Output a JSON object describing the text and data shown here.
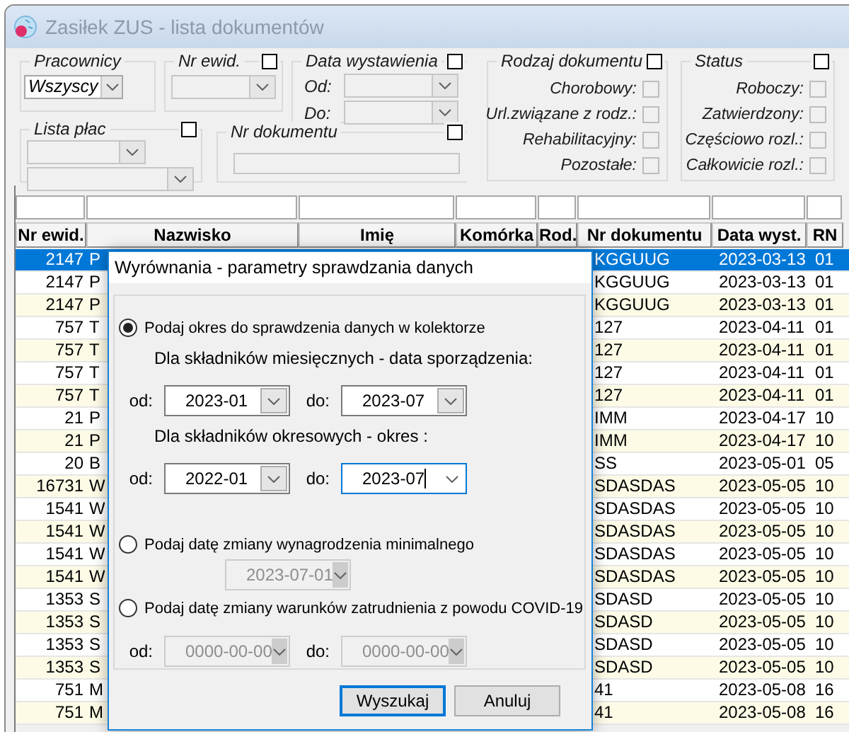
{
  "window": {
    "title": "Zasiłek ZUS - lista dokumentów"
  },
  "filters": {
    "pracownicy": {
      "label": "Pracownicy",
      "value": "Wszyscy"
    },
    "nr_ewid": {
      "label": "Nr ewid.",
      "checked": false
    },
    "data_wystawienia": {
      "label": "Data wystawienia",
      "checked": false,
      "from_label": "Od:",
      "to_label": "Do:"
    },
    "lista_plac": {
      "label": "Lista płac",
      "checked": false
    },
    "nr_dokumentu": {
      "label": "Nr dokumentu",
      "checked": false
    },
    "rodzaj_dokumentu": {
      "label": "Rodzaj dokumentu",
      "checked": false,
      "options": [
        {
          "label": "Chorobowy:",
          "checked": false,
          "disabled": true
        },
        {
          "label": "Url.związane z rodz.:",
          "checked": false,
          "disabled": true
        },
        {
          "label": "Rehabilitacyjny:",
          "checked": false,
          "disabled": true
        },
        {
          "label": "Pozostałe:",
          "checked": false,
          "disabled": true
        }
      ]
    },
    "status": {
      "label": "Status",
      "checked": false,
      "options": [
        {
          "label": "Roboczy:",
          "checked": false,
          "disabled": true
        },
        {
          "label": "Zatwierdzony:",
          "checked": false,
          "disabled": true
        },
        {
          "label": "Częściowo rozl.:",
          "checked": false,
          "disabled": true
        },
        {
          "label": "Całkowicie rozl.:",
          "checked": false,
          "disabled": true
        }
      ]
    }
  },
  "table": {
    "columns": [
      "Nr ewid.",
      "Nazwisko",
      "Imię",
      "Komórka",
      "Rod.",
      "Nr dokumentu",
      "Data wyst.",
      "RN"
    ],
    "rows": [
      {
        "nr_ewid": "2147",
        "nazwisko": "P",
        "nr_dokumentu": "KGGUUG",
        "data_wyst": "2023-03-13",
        "rn": "01",
        "selected": true
      },
      {
        "nr_ewid": "2147",
        "nazwisko": "P",
        "nr_dokumentu": "KGGUUG",
        "data_wyst": "2023-03-13",
        "rn": "01",
        "selected": false
      },
      {
        "nr_ewid": "2147",
        "nazwisko": "P",
        "nr_dokumentu": "KGGUUG",
        "data_wyst": "2023-03-13",
        "rn": "01",
        "selected": false
      },
      {
        "nr_ewid": "757",
        "nazwisko": "T",
        "nr_dokumentu": "127",
        "data_wyst": "2023-04-11",
        "rn": "01",
        "selected": false
      },
      {
        "nr_ewid": "757",
        "nazwisko": "T",
        "nr_dokumentu": "127",
        "data_wyst": "2023-04-11",
        "rn": "01",
        "selected": false
      },
      {
        "nr_ewid": "757",
        "nazwisko": "T",
        "nr_dokumentu": "127",
        "data_wyst": "2023-04-11",
        "rn": "01",
        "selected": false
      },
      {
        "nr_ewid": "757",
        "nazwisko": "T",
        "nr_dokumentu": "127",
        "data_wyst": "2023-04-11",
        "rn": "01",
        "selected": false
      },
      {
        "nr_ewid": "21",
        "nazwisko": "P",
        "nr_dokumentu": "IMM",
        "data_wyst": "2023-04-17",
        "rn": "10",
        "selected": false
      },
      {
        "nr_ewid": "21",
        "nazwisko": "P",
        "nr_dokumentu": "IMM",
        "data_wyst": "2023-04-17",
        "rn": "10",
        "selected": false
      },
      {
        "nr_ewid": "20",
        "nazwisko": "B",
        "nr_dokumentu": "SS",
        "data_wyst": "2023-05-01",
        "rn": "05",
        "selected": false
      },
      {
        "nr_ewid": "16731",
        "nazwisko": "W",
        "nr_dokumentu": "SDASDAS",
        "data_wyst": "2023-05-05",
        "rn": "10",
        "selected": false
      },
      {
        "nr_ewid": "1541",
        "nazwisko": "W",
        "nr_dokumentu": "SDASDAS",
        "data_wyst": "2023-05-05",
        "rn": "10",
        "selected": false
      },
      {
        "nr_ewid": "1541",
        "nazwisko": "W",
        "nr_dokumentu": "SDASDAS",
        "data_wyst": "2023-05-05",
        "rn": "10",
        "selected": false
      },
      {
        "nr_ewid": "1541",
        "nazwisko": "W",
        "nr_dokumentu": "SDASDAS",
        "data_wyst": "2023-05-05",
        "rn": "10",
        "selected": false
      },
      {
        "nr_ewid": "1541",
        "nazwisko": "W",
        "nr_dokumentu": "SDASDAS",
        "data_wyst": "2023-05-05",
        "rn": "10",
        "selected": false
      },
      {
        "nr_ewid": "1353",
        "nazwisko": "S",
        "nr_dokumentu": "SDASD",
        "data_wyst": "2023-05-05",
        "rn": "10",
        "selected": false
      },
      {
        "nr_ewid": "1353",
        "nazwisko": "S",
        "nr_dokumentu": "SDASD",
        "data_wyst": "2023-05-05",
        "rn": "10",
        "selected": false
      },
      {
        "nr_ewid": "1353",
        "nazwisko": "S",
        "nr_dokumentu": "SDASD",
        "data_wyst": "2023-05-05",
        "rn": "10",
        "selected": false
      },
      {
        "nr_ewid": "1353",
        "nazwisko": "S",
        "nr_dokumentu": "SDASD",
        "data_wyst": "2023-05-05",
        "rn": "10",
        "selected": false
      },
      {
        "nr_ewid": "751",
        "nazwisko": "M",
        "nr_dokumentu": "41",
        "data_wyst": "2023-05-08",
        "rn": "16",
        "selected": false
      },
      {
        "nr_ewid": "751",
        "nazwisko": "M",
        "nr_dokumentu": "41",
        "data_wyst": "2023-05-08",
        "rn": "16",
        "selected": false
      }
    ]
  },
  "dialog": {
    "title": "Wyrównania - parametry sprawdzania danych",
    "choices": [
      {
        "label": "Podaj okres do sprawdzenia danych w kolektorze",
        "selected": true,
        "ranges": [
          {
            "caption": "Dla składników miesięcznych - data sporządzenia:",
            "from": {
              "label": "od:",
              "value": "2023-01",
              "disabled": false,
              "focused": false
            },
            "to": {
              "label": "do:",
              "value": "2023-07",
              "disabled": false,
              "focused": false
            }
          },
          {
            "caption": "Dla składników okresowych - okres :",
            "from": {
              "label": "od:",
              "value": "2022-01",
              "disabled": false,
              "focused": false
            },
            "to": {
              "label": "do:",
              "value": "2023-07",
              "disabled": false,
              "focused": true
            }
          }
        ]
      },
      {
        "label": "Podaj datę zmiany wynagrodzenia minimalnego",
        "selected": false,
        "date": {
          "value": "2023-07-01",
          "disabled": true,
          "focused": false
        }
      },
      {
        "label": "Podaj datę zmiany warunków zatrudnienia z powodu COVID-19",
        "selected": false,
        "ranges": [
          {
            "from": {
              "label": "od:",
              "value": "0000-00-00",
              "disabled": true,
              "focused": false
            },
            "to": {
              "label": "do:",
              "value": "0000-00-00",
              "disabled": true,
              "focused": false
            }
          }
        ]
      }
    ],
    "buttons": [
      {
        "label": "Wyszukaj",
        "default": true
      },
      {
        "label": "Anuluj",
        "default": false
      }
    ]
  }
}
